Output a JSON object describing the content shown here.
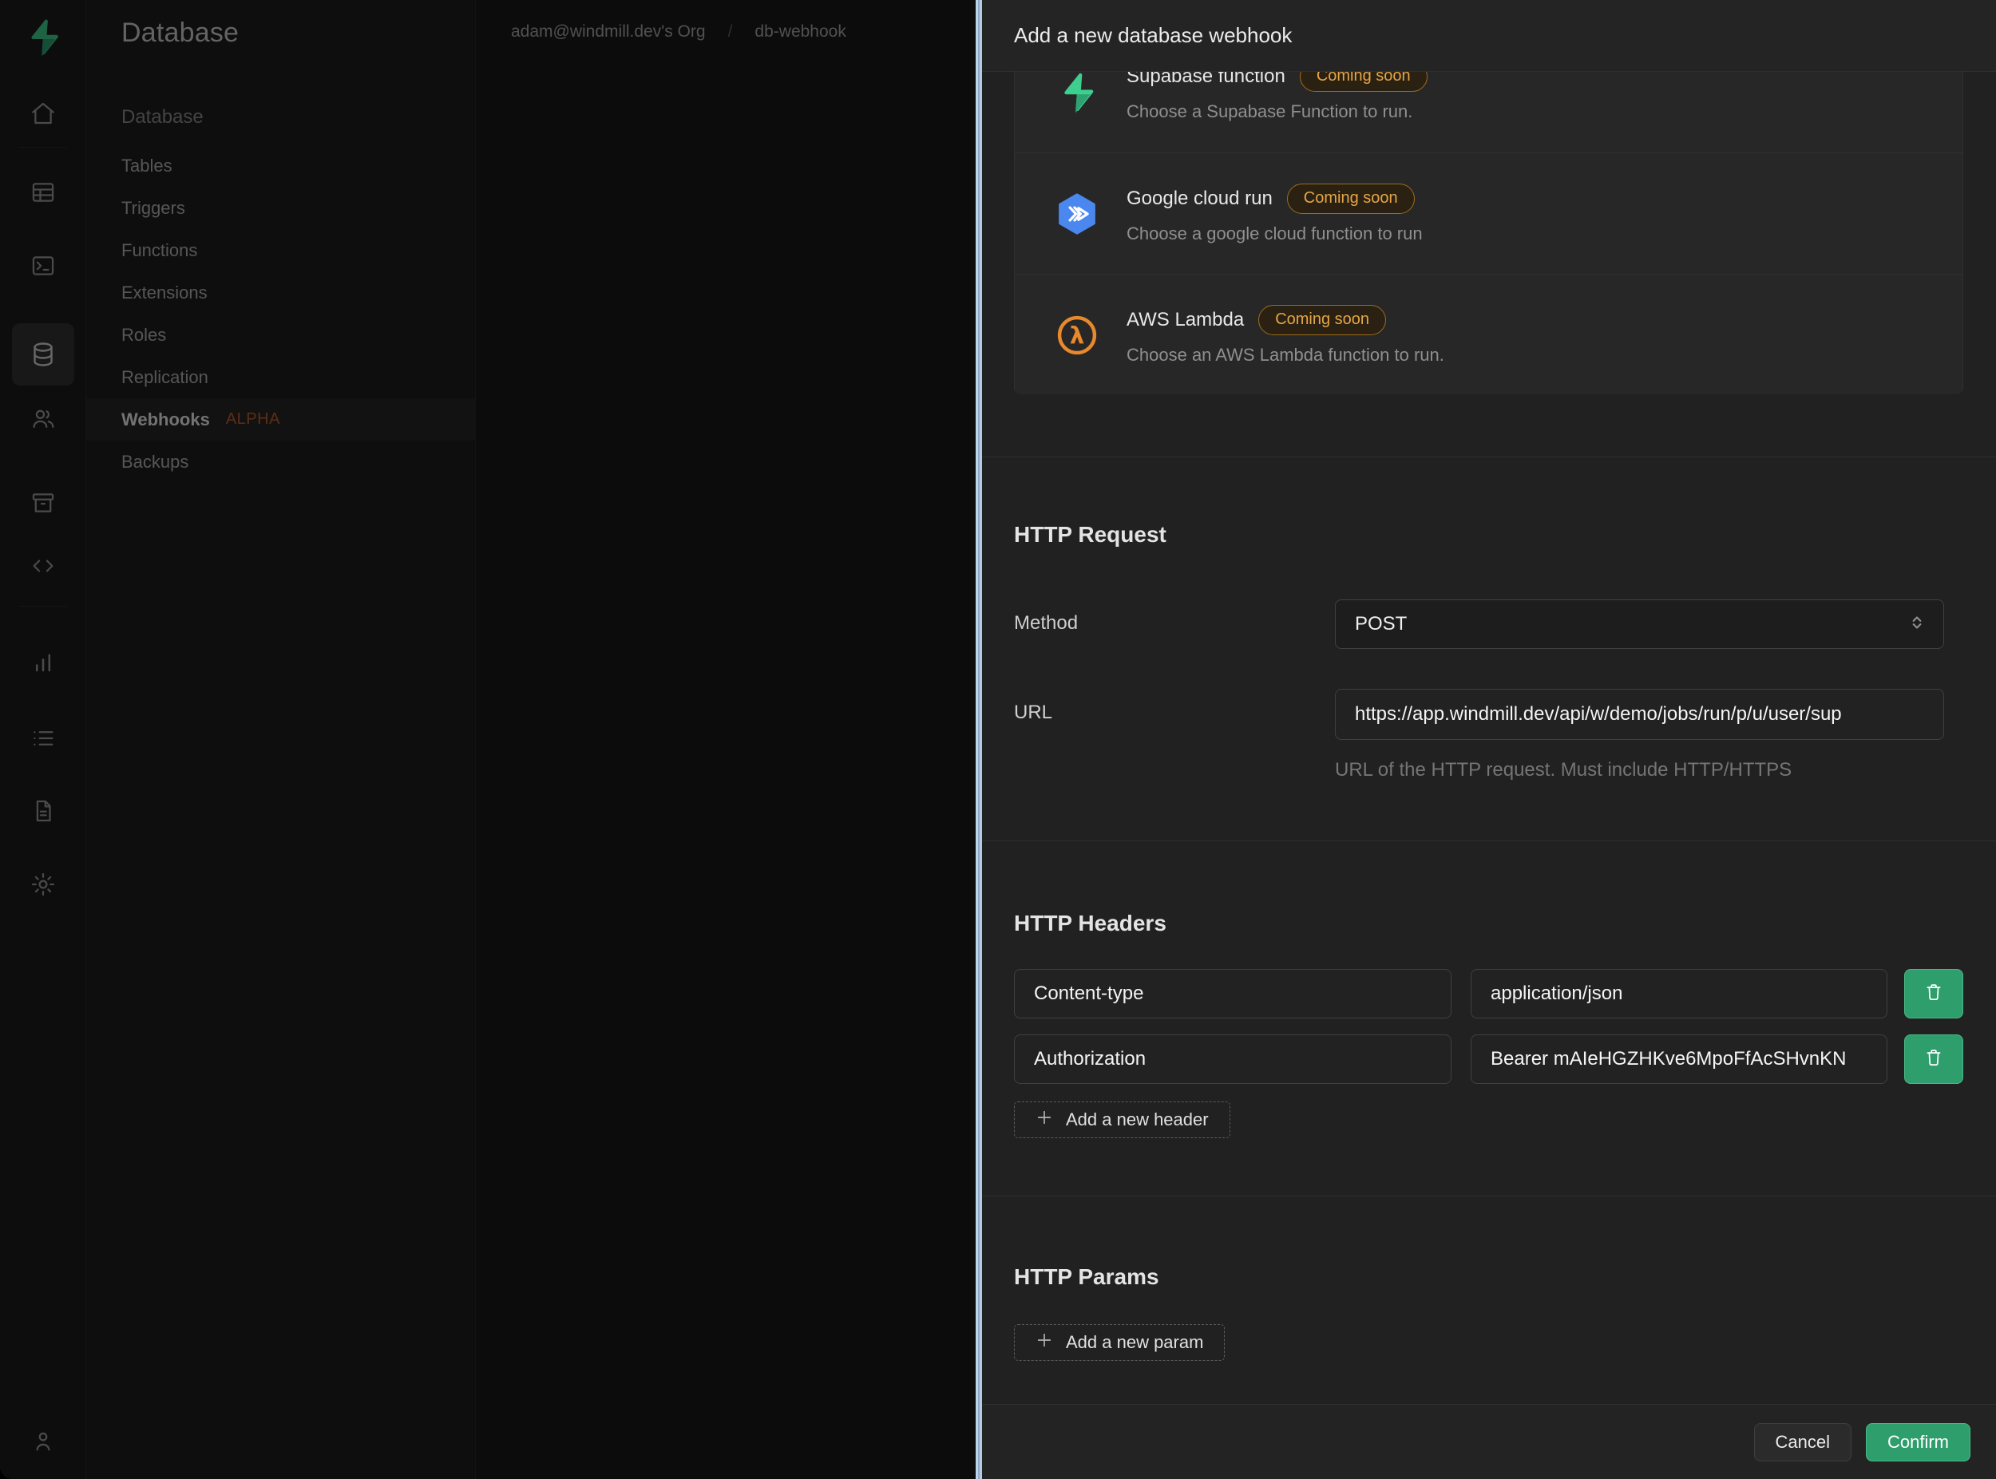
{
  "colors": {
    "accent_green": "#3ecf8e",
    "confirm_green": "#2f9e6d",
    "badge_amber": "#e5a546",
    "alpha_badge_orange": "#c2602e",
    "panel_edge_blue": "#a7c0d9"
  },
  "rail": {
    "logo_icon": "supabase-logo",
    "top_icons": [
      "home",
      "table-editor",
      "sql-editor",
      "database",
      "auth-users",
      "storage",
      "api-code"
    ],
    "bottom_icons": [
      "reports-chart",
      "logs-list",
      "docs-file",
      "settings-gear"
    ],
    "footer_icon": "account-user"
  },
  "sidebar": {
    "page_title": "Database",
    "group_label": "Database",
    "items": [
      {
        "label": "Tables"
      },
      {
        "label": "Triggers"
      },
      {
        "label": "Functions"
      },
      {
        "label": "Extensions"
      },
      {
        "label": "Roles"
      },
      {
        "label": "Replication"
      },
      {
        "label": "Webhooks",
        "badge": "ALPHA"
      },
      {
        "label": "Backups"
      }
    ]
  },
  "breadcrumb": {
    "org": "adam@windmill.dev's Org",
    "separator": "/",
    "project": "db-webhook"
  },
  "panel": {
    "title": "Add a new database webhook",
    "providers": [
      {
        "icon": "supabase-function-icon",
        "name": "Supabase function",
        "badge": "Coming soon",
        "description": "Choose a Supabase Function to run."
      },
      {
        "icon": "google-cloud-run-icon",
        "name": "Google cloud run",
        "badge": "Coming soon",
        "description": "Choose a google cloud function to run"
      },
      {
        "icon": "aws-lambda-icon",
        "name": "AWS Lambda",
        "badge": "Coming soon",
        "description": "Choose an AWS Lambda function to run."
      }
    ],
    "http_request": {
      "heading": "HTTP Request",
      "method_label": "Method",
      "method_value": "POST",
      "url_label": "URL",
      "url_value": "https://app.windmill.dev/api/w/demo/jobs/run/p/u/user/sup",
      "url_help": "URL of the HTTP request. Must include HTTP/HTTPS"
    },
    "http_headers": {
      "heading": "HTTP Headers",
      "rows": [
        {
          "key": "Content-type",
          "value": "application/json"
        },
        {
          "key": "Authorization",
          "value": "Bearer mAIeHGZHKve6MpoFfAcSHvnKN"
        }
      ],
      "add_label": "Add a new header"
    },
    "http_params": {
      "heading": "HTTP Params",
      "add_label": "Add a new param"
    },
    "footer": {
      "cancel": "Cancel",
      "confirm": "Confirm"
    }
  }
}
